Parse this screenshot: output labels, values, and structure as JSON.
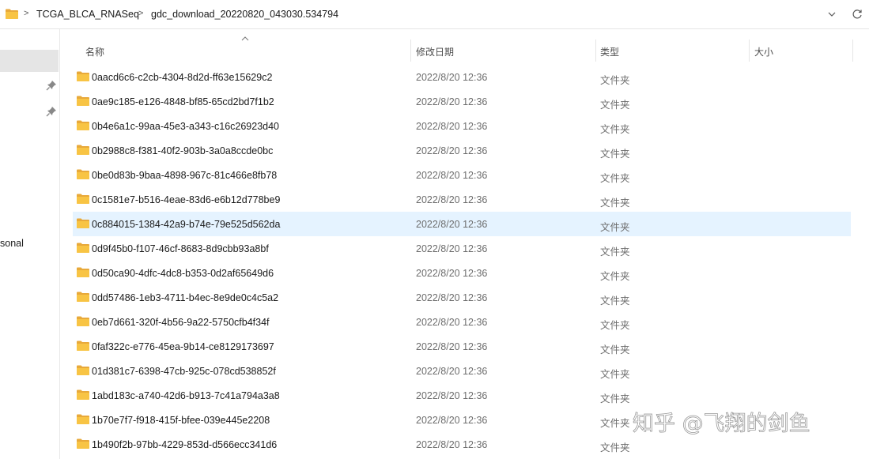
{
  "address_bar": {
    "crumbs": [
      "TCGA_BLCA_RNASeq",
      "gdc_download_20220820_043030.534794"
    ],
    "separator": ">"
  },
  "nav": {
    "partial_item_label": "sonal"
  },
  "columns": {
    "name": "名称",
    "date_modified": "修改日期",
    "type": "类型",
    "size": "大小"
  },
  "files": [
    {
      "name": "0aacd6c6-c2cb-4304-8d2d-ff63e15629c2",
      "date": "2022/8/20 12:36",
      "type": "文件夹",
      "selected": false
    },
    {
      "name": "0ae9c185-e126-4848-bf85-65cd2bd7f1b2",
      "date": "2022/8/20 12:36",
      "type": "文件夹",
      "selected": false
    },
    {
      "name": "0b4e6a1c-99aa-45e3-a343-c16c26923d40",
      "date": "2022/8/20 12:36",
      "type": "文件夹",
      "selected": false
    },
    {
      "name": "0b2988c8-f381-40f2-903b-3a0a8ccde0bc",
      "date": "2022/8/20 12:36",
      "type": "文件夹",
      "selected": false
    },
    {
      "name": "0be0d83b-9baa-4898-967c-81c466e8fb78",
      "date": "2022/8/20 12:36",
      "type": "文件夹",
      "selected": false
    },
    {
      "name": "0c1581e7-b516-4eae-83d6-e6b12d778be9",
      "date": "2022/8/20 12:36",
      "type": "文件夹",
      "selected": false
    },
    {
      "name": "0c884015-1384-42a9-b74e-79e525d562da",
      "date": "2022/8/20 12:36",
      "type": "文件夹",
      "selected": true
    },
    {
      "name": "0d9f45b0-f107-46cf-8683-8d9cbb93a8bf",
      "date": "2022/8/20 12:36",
      "type": "文件夹",
      "selected": false
    },
    {
      "name": "0d50ca90-4dfc-4dc8-b353-0d2af65649d6",
      "date": "2022/8/20 12:36",
      "type": "文件夹",
      "selected": false
    },
    {
      "name": "0dd57486-1eb3-4711-b4ec-8e9de0c4c5a2",
      "date": "2022/8/20 12:36",
      "type": "文件夹",
      "selected": false
    },
    {
      "name": "0eb7d661-320f-4b56-9a22-5750cfb4f34f",
      "date": "2022/8/20 12:36",
      "type": "文件夹",
      "selected": false
    },
    {
      "name": "0faf322c-e776-45ea-9b14-ce8129173697",
      "date": "2022/8/20 12:36",
      "type": "文件夹",
      "selected": false
    },
    {
      "name": "01d381c7-6398-47cb-925c-078cd538852f",
      "date": "2022/8/20 12:36",
      "type": "文件夹",
      "selected": false
    },
    {
      "name": "1abd183c-a740-42d6-b913-7c41a794a3a8",
      "date": "2022/8/20 12:36",
      "type": "文件夹",
      "selected": false
    },
    {
      "name": "1b70e7f7-f918-415f-bfee-039e445e2208",
      "date": "2022/8/20 12:36",
      "type": "文件夹",
      "selected": false
    },
    {
      "name": "1b490f2b-97bb-4229-853d-d566ecc341d6",
      "date": "2022/8/20 12:36",
      "type": "文件夹",
      "selected": false
    }
  ],
  "watermark": {
    "text": "知乎 @飞翔的剑鱼"
  },
  "colors": {
    "folder": "#f8c444",
    "selected_row": "#e5f3ff",
    "nav_selected": "#e5e5e5"
  }
}
